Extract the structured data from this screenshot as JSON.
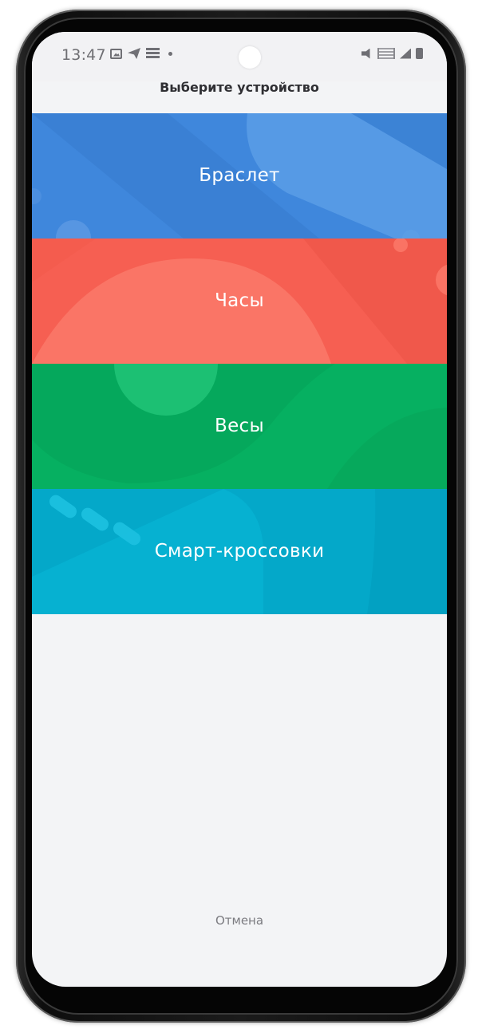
{
  "status_bar": {
    "time": "13:47",
    "left_icons": [
      "gallery-icon",
      "telegram-icon",
      "notification-stack-icon",
      "dot-icon"
    ],
    "right_icons": [
      "mute-icon",
      "volte-icon",
      "signal-icon",
      "battery-icon"
    ]
  },
  "dialog": {
    "title": "Выберите устройство",
    "devices": [
      {
        "label": "Браслет",
        "color": "#3f87dc"
      },
      {
        "label": "Часы",
        "color": "#f65f52"
      },
      {
        "label": "Весы",
        "color": "#06b061"
      },
      {
        "label": "Смарт-кроссовки",
        "color": "#04a8c9"
      }
    ],
    "cancel_label": "Отмена"
  }
}
